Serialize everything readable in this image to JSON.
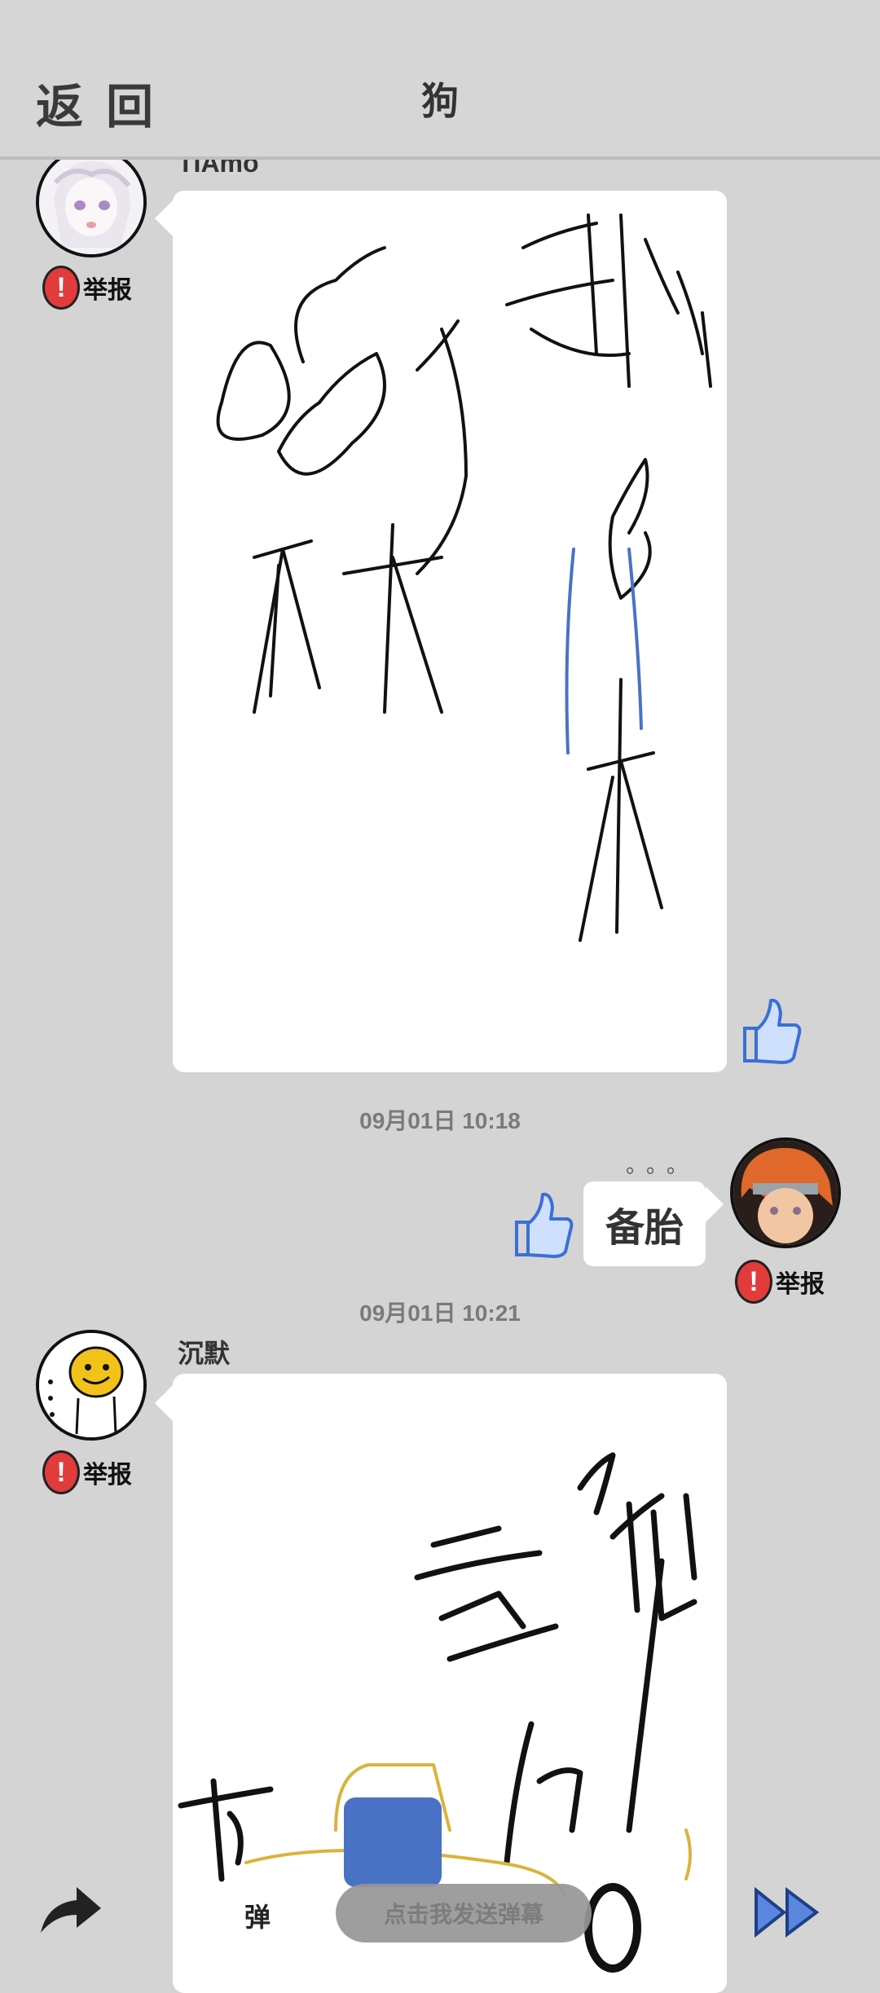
{
  "header": {
    "back_label": "返 回",
    "title": "狗"
  },
  "messages": [
    {
      "user": "TIAmo",
      "report_label": "举报"
    },
    {
      "timestamp": "09月01日  10:18",
      "text": "备胎",
      "typing": "。。。",
      "report_label": "举报"
    },
    {
      "timestamp": "09月01日  10:21",
      "user": "沉默",
      "report_label": "举报"
    }
  ],
  "bottom": {
    "danmu_placeholder": "点击我发送弹幕",
    "danmu_toggle_label": "弹"
  },
  "colors": {
    "background": "#d4d4d4",
    "report_red": "#e23b3b",
    "like_blue": "#3a6fd8"
  },
  "icons": [
    "report-icon",
    "like-icon",
    "share-icon",
    "fast-forward-icon"
  ]
}
